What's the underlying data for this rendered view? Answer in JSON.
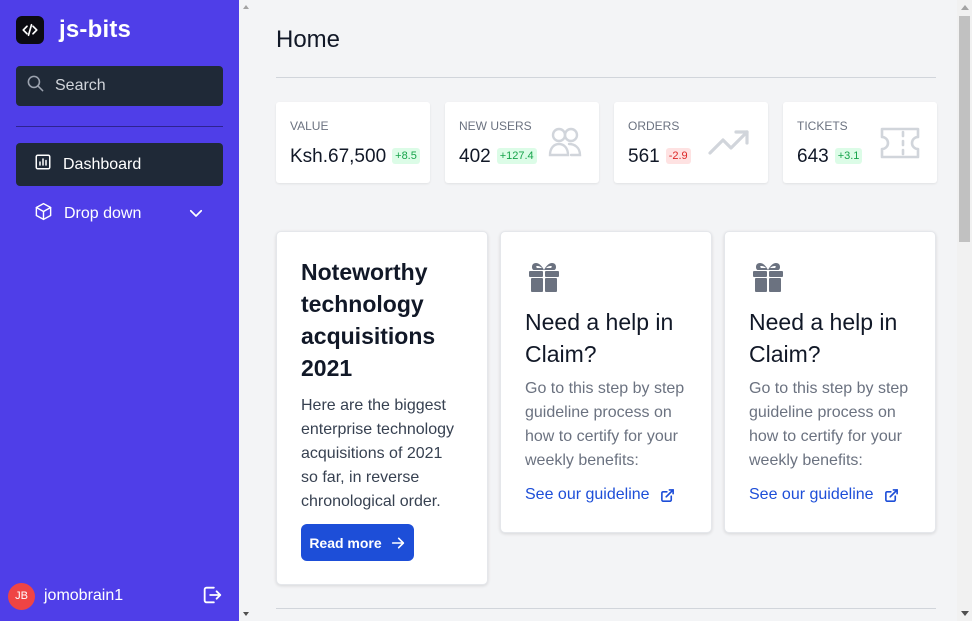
{
  "brand": {
    "name": "js-bits",
    "logo_icon": "code-icon"
  },
  "search": {
    "placeholder": "Search",
    "value": ""
  },
  "sidebar": {
    "items": [
      {
        "label": "Dashboard",
        "icon": "bar-chart-icon",
        "active": true
      },
      {
        "label": "Drop down",
        "icon": "cube-icon",
        "has_submenu": true
      }
    ]
  },
  "user": {
    "initials": "JB",
    "name": "jomobrain1"
  },
  "page": {
    "title": "Home"
  },
  "stats": [
    {
      "label": "VALUE",
      "value": "Ksh.67,500",
      "delta": "+8.5",
      "trend": "up"
    },
    {
      "label": "NEW USERS",
      "value": "402",
      "delta": "+127.4",
      "trend": "up",
      "icon": "users-icon"
    },
    {
      "label": "ORDERS",
      "value": "561",
      "delta": "-2.9",
      "trend": "down",
      "icon": "trending-up-icon"
    },
    {
      "label": "TICKETS",
      "value": "643",
      "delta": "+3.1",
      "trend": "up",
      "icon": "ticket-icon"
    }
  ],
  "article": {
    "title": "Noteworthy technology acquisitions 2021",
    "body": "Here are the biggest enterprise technology acquisitions of 2021 so far, in reverse chronological order.",
    "button": "Read more"
  },
  "help_cards": [
    {
      "title": "Need a help in Claim?",
      "body": "Go to this step by step guideline process on how to certify for your weekly benefits:",
      "link": "See our guideline"
    },
    {
      "title": "Need a help in Claim?",
      "body": "Go to this step by step guideline process on how to certify for your weekly benefits:",
      "link": "See our guideline"
    }
  ],
  "colors": {
    "sidebar_bg": "#4f3ee8",
    "dark": "#1f2937",
    "primary": "#1d4ed8",
    "avatar": "#ef4444",
    "delta_up": "#16a34a",
    "delta_down": "#dc2626"
  }
}
